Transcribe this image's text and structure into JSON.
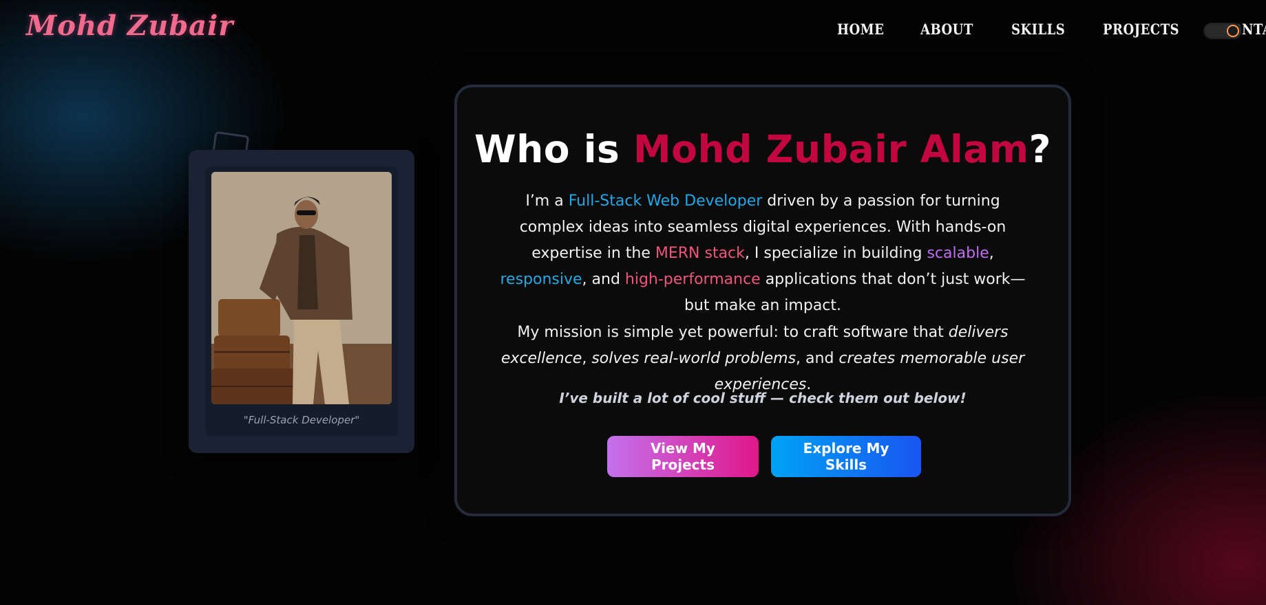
{
  "header": {
    "logo": "Mohd Zubair",
    "nav": [
      "HOME",
      "ABOUT",
      "SKILLS",
      "PROJECTS",
      "CONTACT"
    ],
    "theme_toggle": {
      "state": "dark"
    }
  },
  "profile": {
    "caption": "\"Full-Stack Developer\""
  },
  "intro": {
    "title_prefix": "Who is ",
    "title_name": "Mohd Zubair Alam",
    "title_suffix": "?",
    "p1": [
      "I’m a ",
      "Full-Stack Web Developer",
      " driven by a passion for turning complex ideas into seamless digital experiences. With hands-on expertise in the ",
      "MERN stack",
      ", I specialize in building ",
      "scalable",
      ", ",
      "responsive",
      ", and ",
      "high-performance",
      " applications that don’t just work—but make an impact."
    ],
    "p2": [
      "My mission is simple yet powerful: to craft software that ",
      "delivers excellence",
      ", ",
      "solves real-world problems",
      ", and ",
      "creates memorable user experiences",
      "."
    ],
    "tagline": "I’ve built a lot of cool stuff — check them out below!",
    "buttons": {
      "projects": "View My Projects",
      "skills": "Explore My Skills"
    }
  },
  "colors": {
    "accent_name": "#c2063f",
    "blue": "#20a8e8",
    "pink": "#f1557c",
    "purple": "#c06ef0"
  }
}
